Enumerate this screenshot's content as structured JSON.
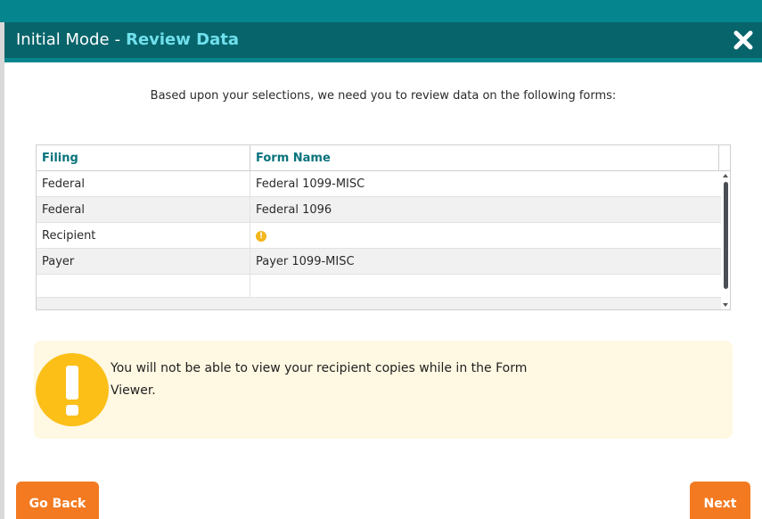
{
  "dialog": {
    "title_mode": "Initial Mode",
    "title_separator": "-",
    "title_section": "Review Data",
    "close_icon": "close-icon"
  },
  "intro_text": "Based upon your selections, we need you to review data on the following forms:",
  "grid": {
    "columns": [
      "Filing",
      "Form Name"
    ],
    "rows": [
      {
        "filing": "Federal",
        "form_name": "Federal 1099-MISC",
        "warning": false
      },
      {
        "filing": "Federal",
        "form_name": "Federal 1096",
        "warning": false
      },
      {
        "filing": "Recipient",
        "form_name": "",
        "warning": true
      },
      {
        "filing": "Payer",
        "form_name": "Payer 1099-MISC",
        "warning": false
      }
    ],
    "warning_glyph": "!"
  },
  "notice": {
    "icon": "exclamation-icon",
    "line1": "You will not be able to view your recipient copies while in the Form",
    "line2": "Viewer."
  },
  "buttons": {
    "back_label": "Go Back",
    "next_label": "Next"
  },
  "colors": {
    "titlebar": "#08646b",
    "accent": "#6fe0ec",
    "button": "#f37a21",
    "warning": "#fbbf18"
  }
}
